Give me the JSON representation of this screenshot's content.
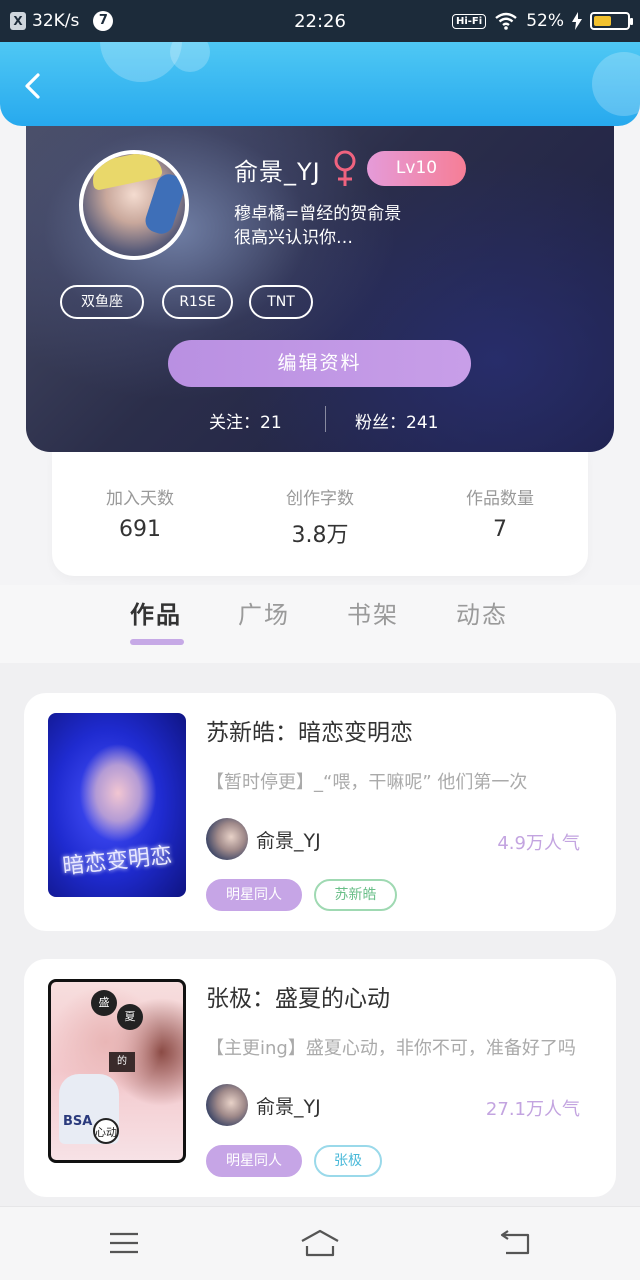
{
  "status_bar": {
    "speed": "32K/s",
    "notification_count": "7",
    "time": "22:26",
    "hifi": "Hi-Fi",
    "battery_percent": "52%",
    "battery_level": 0.52
  },
  "profile": {
    "username": "俞景_YJ",
    "level": "Lv10",
    "bio_line1": "穆卓橘=曾经的贺俞景",
    "bio_line2": "很高兴认识你…",
    "tags": [
      "双鱼座",
      "R1SE",
      "TNT"
    ],
    "edit_button": "编辑资料",
    "following_label": "关注：",
    "following_count": "21",
    "followers_label": "粉丝：",
    "followers_count": "241"
  },
  "stats": [
    {
      "label": "加入天数",
      "value": "691"
    },
    {
      "label": "创作字数",
      "value": "3.8万"
    },
    {
      "label": "作品数量",
      "value": "7"
    }
  ],
  "tabs": [
    {
      "label": "作品",
      "active": true
    },
    {
      "label": "广场",
      "active": false
    },
    {
      "label": "书架",
      "active": false
    },
    {
      "label": "动态",
      "active": false
    }
  ],
  "works": [
    {
      "title": "苏新皓：暗恋变明恋",
      "description": "【暂时停更】_“喂，干嘛呢” 他们第一次",
      "author": "俞景_YJ",
      "popularity": "4.9万人气",
      "category": "明星同人",
      "tag": "苏新皓",
      "cover_text": "暗恋变明恋"
    },
    {
      "title": "张极：盛夏的心动",
      "description": "【主更ing】盛夏心动，非你不可，准备好了吗",
      "author": "俞景_YJ",
      "popularity": "27.1万人气",
      "category": "明星同人",
      "tag": "张极",
      "cover_text": "心动"
    }
  ],
  "colors": {
    "header_blue": "#27a9ee",
    "level_pink": "#f67e96",
    "accent_purple": "#c6a5e6",
    "gender_pink": "#f0637f"
  },
  "icons": {
    "back": "chevron-left-icon",
    "gender": "female-icon",
    "nav_menu": "menu-icon",
    "nav_home": "home-icon",
    "nav_back": "back-icon"
  }
}
